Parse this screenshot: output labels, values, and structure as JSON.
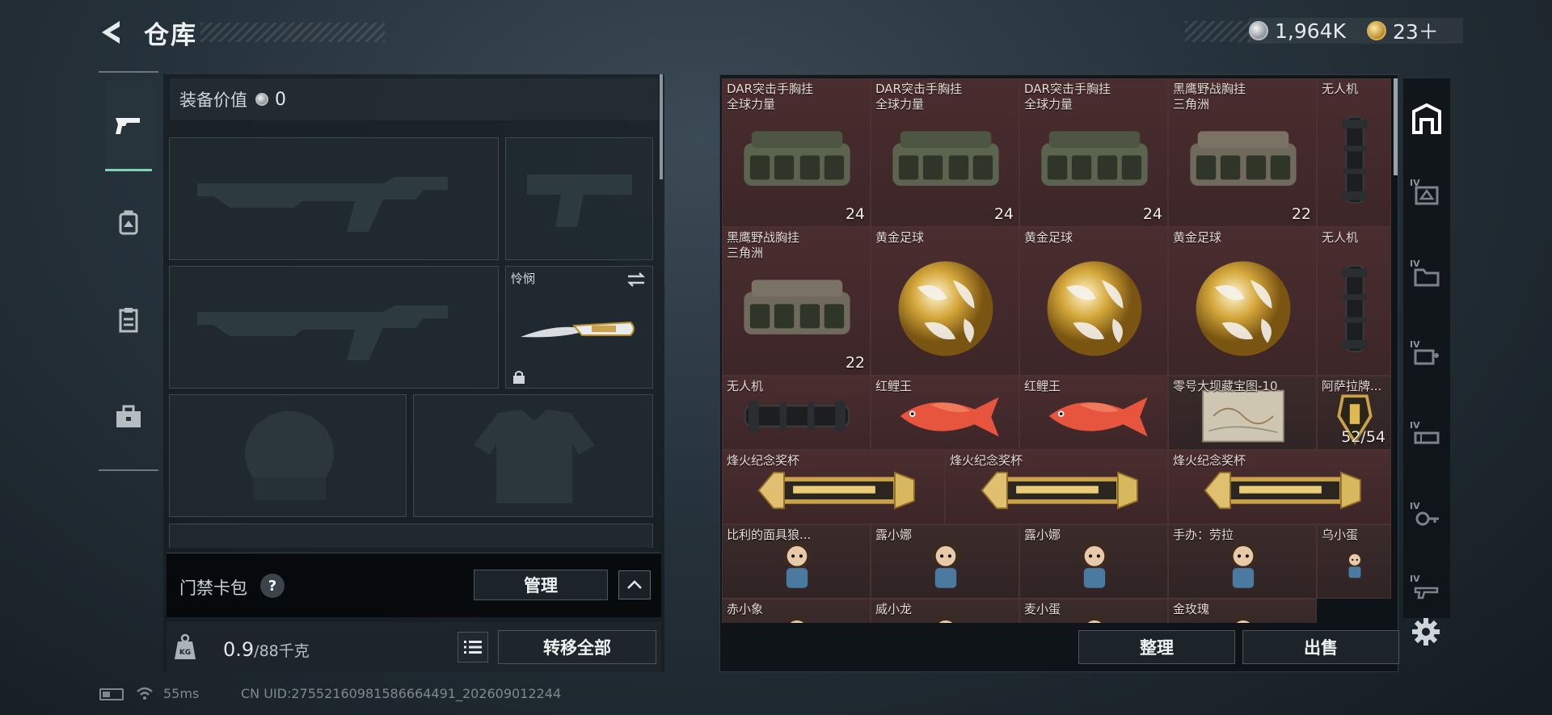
{
  "header": {
    "title": "仓库",
    "currency": [
      {
        "icon": "silver-coin-icon",
        "value": "1,964K"
      },
      {
        "icon": "gold-coin-icon",
        "value": "23＋"
      }
    ]
  },
  "left_tabs": [
    {
      "icon": "pistol-icon",
      "active": true
    },
    {
      "icon": "backpack-icon",
      "active": false
    },
    {
      "icon": "clipboard-icon",
      "active": false
    },
    {
      "icon": "toolbox-icon",
      "active": false
    }
  ],
  "equipment": {
    "value_label": "装备价值",
    "value": "0",
    "melee_name": "怜悯",
    "slots": [
      "primary-weapon",
      "pistol",
      "secondary-weapon",
      "melee",
      "helmet",
      "armor"
    ]
  },
  "access_card": {
    "label": "门禁卡包",
    "help": "?",
    "manage_label": "管理"
  },
  "weight": {
    "current": "0.9",
    "max": "/88千克"
  },
  "buttons": {
    "transfer_all": "转移全部",
    "sort": "整理",
    "sell": "出售"
  },
  "inventory": [
    {
      "name": "DAR突击手胸挂\n全球力量",
      "count": "24",
      "art": "chest-rig",
      "bg": "a"
    },
    {
      "name": "DAR突击手胸挂\n全球力量",
      "count": "24",
      "art": "chest-rig",
      "bg": "a"
    },
    {
      "name": "DAR突击手胸挂\n全球力量",
      "count": "24",
      "art": "chest-rig",
      "bg": "a"
    },
    {
      "name": "黑鹰野战胸挂\n三角洲",
      "count": "22",
      "art": "chest-rig-tan",
      "bg": "a"
    },
    {
      "name": "无人机",
      "count": "",
      "art": "drone",
      "bg": "a"
    },
    {
      "name": "黑鹰野战胸挂\n三角洲",
      "count": "22",
      "art": "chest-rig-tan",
      "bg": "a"
    },
    {
      "name": "黄金足球",
      "count": "",
      "art": "gold-ball",
      "bg": "a"
    },
    {
      "name": "黄金足球",
      "count": "",
      "art": "gold-ball",
      "bg": "a"
    },
    {
      "name": "黄金足球",
      "count": "",
      "art": "gold-ball",
      "bg": "a"
    },
    {
      "name": "无人机",
      "count": "",
      "art": "drone",
      "bg": "a"
    },
    {
      "name": "无人机",
      "count": "",
      "art": "drone-h",
      "bg": "a"
    },
    {
      "name": "红鲤王",
      "count": "",
      "art": "fish",
      "bg": "a"
    },
    {
      "name": "红鲤王",
      "count": "",
      "art": "fish",
      "bg": "a"
    },
    {
      "name": "零号大坝藏宝图-10",
      "count": "",
      "art": "map",
      "bg": "b"
    },
    {
      "name": "阿萨拉牌...",
      "count": "52/54",
      "art": "badge",
      "bg": "b"
    },
    {
      "name": "烽火纪念奖杯",
      "count": "",
      "art": "trophy",
      "bg": "a"
    },
    {
      "name": "烽火纪念奖杯",
      "count": "",
      "art": "trophy",
      "bg": "a"
    },
    {
      "name": "烽火纪念奖杯",
      "count": "",
      "art": "trophy",
      "bg": "a"
    },
    {
      "name": "比利的面具狼...",
      "count": "",
      "art": "figure",
      "bg": "b"
    },
    {
      "name": "露小娜",
      "count": "",
      "art": "figure",
      "bg": "b"
    },
    {
      "name": "露小娜",
      "count": "",
      "art": "figure",
      "bg": "b"
    },
    {
      "name": "手办：劳拉",
      "count": "",
      "art": "figure",
      "bg": "b"
    },
    {
      "name": "乌小蛋",
      "count": "",
      "art": "figure",
      "bg": "b"
    },
    {
      "name": "赤小象",
      "count": "",
      "art": "figure",
      "bg": "b"
    },
    {
      "name": "威小龙",
      "count": "",
      "art": "figure",
      "bg": "b"
    },
    {
      "name": "麦小蛋",
      "count": "",
      "art": "figure",
      "bg": "b"
    },
    {
      "name": "金玫瑰",
      "count": "",
      "art": "figure",
      "bg": "b"
    }
  ],
  "categories": [
    "storage-icon",
    "drawing-icon",
    "folder-icon",
    "medical-icon",
    "ammo-icon",
    "key-icon",
    "weapon-icon"
  ],
  "category_tier": "IV",
  "status_bar": {
    "ping": "55ms",
    "uid": "CN UID:275521609815866644​91_202609012244"
  }
}
